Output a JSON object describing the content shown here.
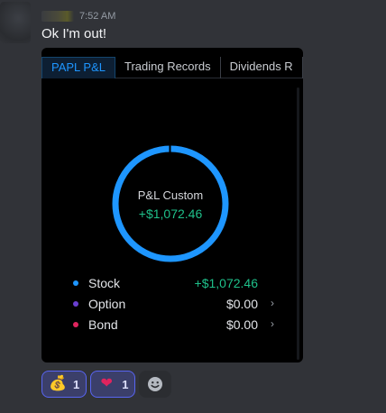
{
  "message": {
    "timestamp": "7:52 AM",
    "text": "Ok I'm out!"
  },
  "embed": {
    "tabs": [
      {
        "label": "PAPL P&L",
        "active": true
      },
      {
        "label": "Trading Records",
        "active": false
      },
      {
        "label": "Dividends R",
        "active": false
      }
    ],
    "donut": {
      "title": "P&L Custom",
      "value": "+$1,072.46",
      "ring_color": "#1e96ff"
    },
    "legend": [
      {
        "label": "Stock",
        "value": "+$1,072.46",
        "color": "#1e96ff",
        "chevron": ""
      },
      {
        "label": "Option",
        "value": "$0.00",
        "color": "#6a3fd1",
        "chevron": "›"
      },
      {
        "label": "Bond",
        "value": "$0.00",
        "color": "#e0245e",
        "chevron": "›"
      }
    ]
  },
  "reactions": [
    {
      "emoji": "💰",
      "icon": "money-bag-icon",
      "count": "1"
    },
    {
      "emoji": "❤",
      "icon": "heart-icon",
      "count": "1"
    }
  ],
  "add_reaction_icon": "smile-add-icon"
}
